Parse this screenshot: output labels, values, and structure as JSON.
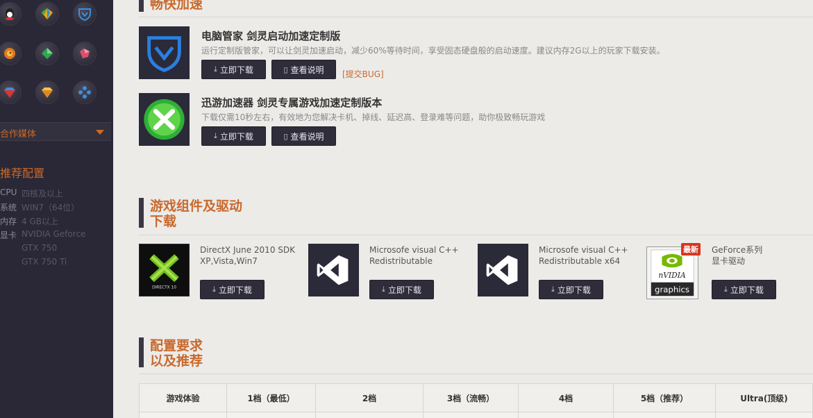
{
  "sidebar": {
    "media_label": "合作媒体",
    "recommend_title": "推荐配置",
    "specs": [
      {
        "key": "CPU",
        "value": "四核及以上"
      },
      {
        "key": "系统",
        "value": "WIN7（64位）"
      },
      {
        "key": "内存",
        "value": "4 GB以上"
      },
      {
        "key": "显卡",
        "value": "NVIDIA Geforce"
      },
      {
        "key": "",
        "value": "GTX 750"
      },
      {
        "key": "",
        "value": "GTX 750 Ti"
      }
    ]
  },
  "accel_section": {
    "title": "畅快加速",
    "apps": [
      {
        "title": "电脑管家 剑灵启动加速定制版",
        "desc": "运行定制版管家，可以让剑灵加速启动，减少60%等待时间，享受固态硬盘般的启动速度。建议内存2G以上的玩家下载安装。",
        "download": "立即下载",
        "info": "查看说明",
        "bug": "[提交BUG]"
      },
      {
        "title": "迅游加速器 剑灵专属游戏加速定制版本",
        "desc": "下载仅需10秒左右，有效地为您解决卡机、掉线、延迟高、登录难等问题，助你极致畅玩游戏",
        "download": "立即下载",
        "info": "查看说明"
      }
    ]
  },
  "driver_section": {
    "title_line1": "游戏组件及驱动",
    "title_line2": "下载",
    "items": [
      {
        "name_line1": "DirectX June 2010 SDK",
        "name_line2": "XP,Vista,Win7",
        "download": "立即下载",
        "thumb_caption": "DIRECTX 10"
      },
      {
        "name_line1": "Microsofe visual C++",
        "name_line2": "Redistributable",
        "download": "立即下载"
      },
      {
        "name_line1": "Microsofe visual C++",
        "name_line2": "Redistributable x64",
        "download": "立即下载"
      },
      {
        "name_line1": "GeForce系列",
        "name_line2": "显卡驱动",
        "download": "立即下载",
        "badge": "最新",
        "thumb_brand": "nVIDIA",
        "thumb_caption": "graphics"
      }
    ]
  },
  "config_section": {
    "title_line1": "配置要求",
    "title_line2": "以及推荐",
    "columns": [
      "游戏体验",
      "1档（最低）",
      "2档",
      "3档（流畅）",
      "4档",
      "5档（推荐）",
      "Ultra(顶级)"
    ]
  },
  "colors": {
    "accent": "#c9692d",
    "sidebar_bg": "#2a2836",
    "button_bg": "#2f2d3a"
  }
}
